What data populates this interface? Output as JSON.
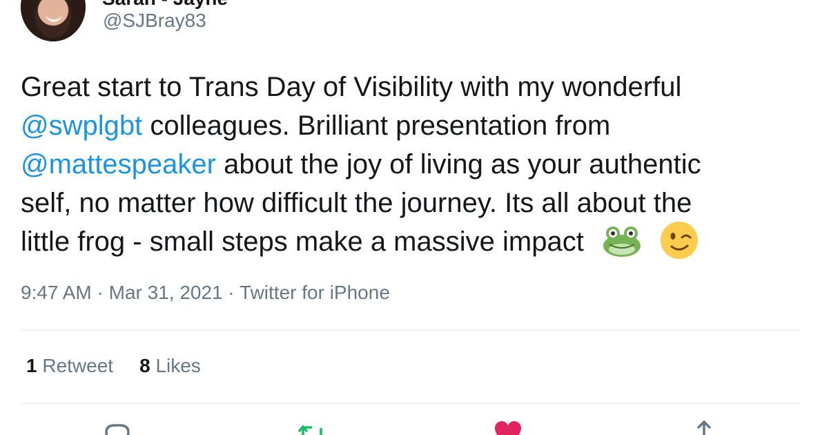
{
  "author": {
    "display_name": "Sarah - Jayne",
    "handle": "@SJBray83"
  },
  "tweet": {
    "lines": [
      [
        {
          "t": "Great start to Trans Day of Visibility with my wonderful",
          "m": false
        }
      ],
      [
        {
          "t": "@swplgbt",
          "m": true
        },
        {
          "t": " colleagues. Brilliant presentation from",
          "m": false
        }
      ],
      [
        {
          "t": "@mattespeaker",
          "m": true
        },
        {
          "t": " about the joy of living as your authentic",
          "m": false
        }
      ],
      [
        {
          "t": "self, no matter how difficult the journey.  Its all about the",
          "m": false
        }
      ],
      [
        {
          "t": "little frog - small steps make a massive impact",
          "m": false
        }
      ]
    ],
    "emojis": [
      "frog-emoji",
      "winking-face-emoji"
    ]
  },
  "meta": {
    "time": "9:47 AM",
    "date": "Mar 31, 2021",
    "source": "Twitter for iPhone",
    "separator": " · "
  },
  "stats": {
    "retweets_count": "1",
    "retweets_label": "Retweet",
    "likes_count": "8",
    "likes_label": "Likes"
  },
  "actions": [
    "reply-icon",
    "retweet-icon",
    "like-icon",
    "share-icon"
  ],
  "colors": {
    "text": "#14171a",
    "secondary": "#657786",
    "link": "#1b95e0",
    "divider": "#e6ecf0",
    "retweet": "#17bf63",
    "like": "#e0245e"
  }
}
